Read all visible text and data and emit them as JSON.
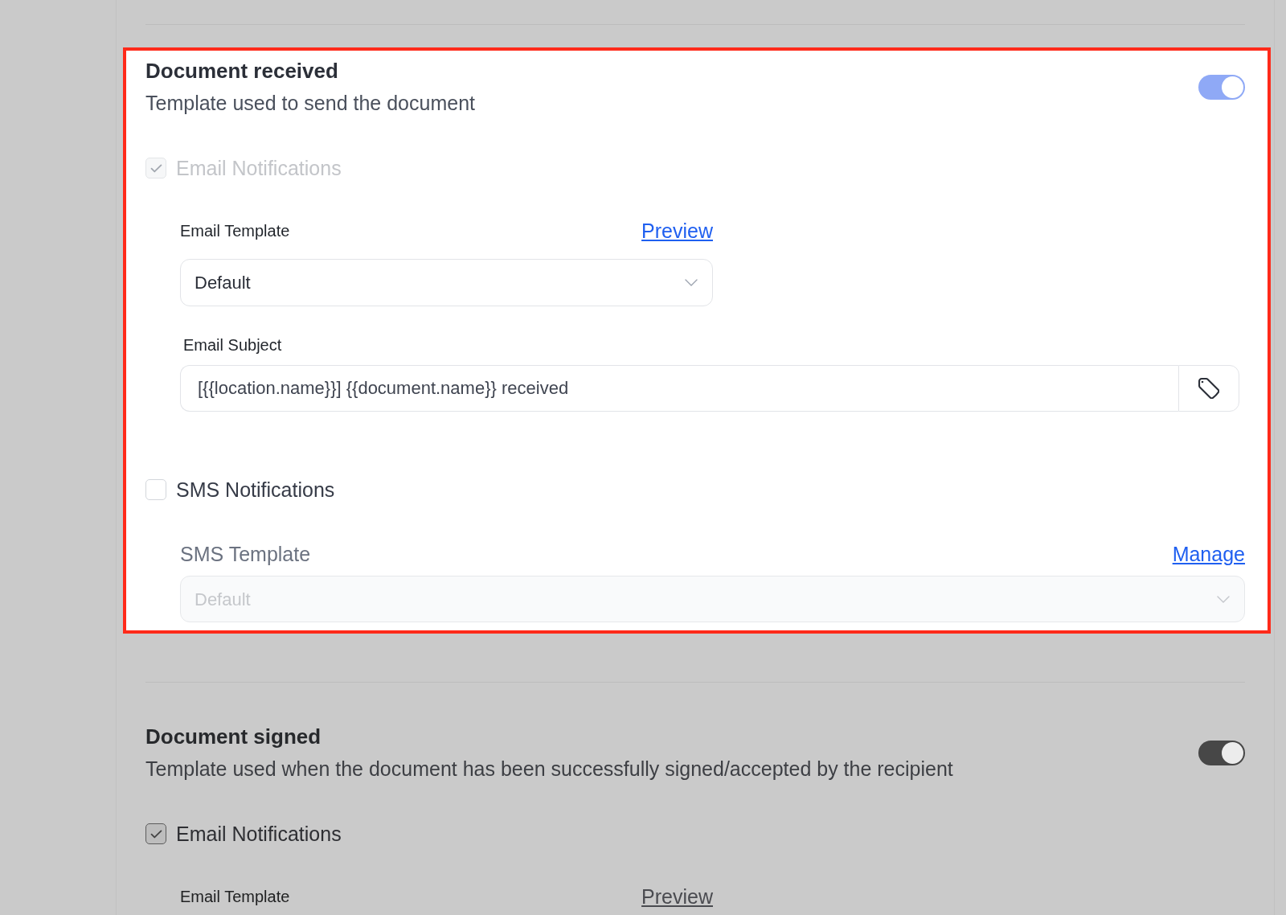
{
  "sections": [
    {
      "title": "Document received",
      "description": "Template used to send the document",
      "highlighted": true,
      "on": true,
      "channels": [
        {
          "kind": "email",
          "label": "Email Notifications",
          "checked": true,
          "disabled": true,
          "template": {
            "label": "Email Template",
            "link": "Preview",
            "value": "Default",
            "disabled": false
          },
          "subject": {
            "label": "Email Subject",
            "value": "[{{location.name}}] {{document.name}} received"
          }
        },
        {
          "kind": "sms",
          "label": "SMS Notifications",
          "checked": false,
          "disabled": false,
          "template": {
            "label": "SMS Template",
            "link": "Manage",
            "value": "Default",
            "disabled": true
          }
        }
      ]
    },
    {
      "title": "Document signed",
      "description": "Template used when the document has been successfully signed/accepted by the recipient",
      "highlighted": false,
      "on": true,
      "channels": [
        {
          "kind": "email",
          "label": "Email Notifications",
          "checked": true,
          "disabled": false,
          "template": {
            "label": "Email Template",
            "link": "Preview"
          }
        }
      ]
    }
  ]
}
